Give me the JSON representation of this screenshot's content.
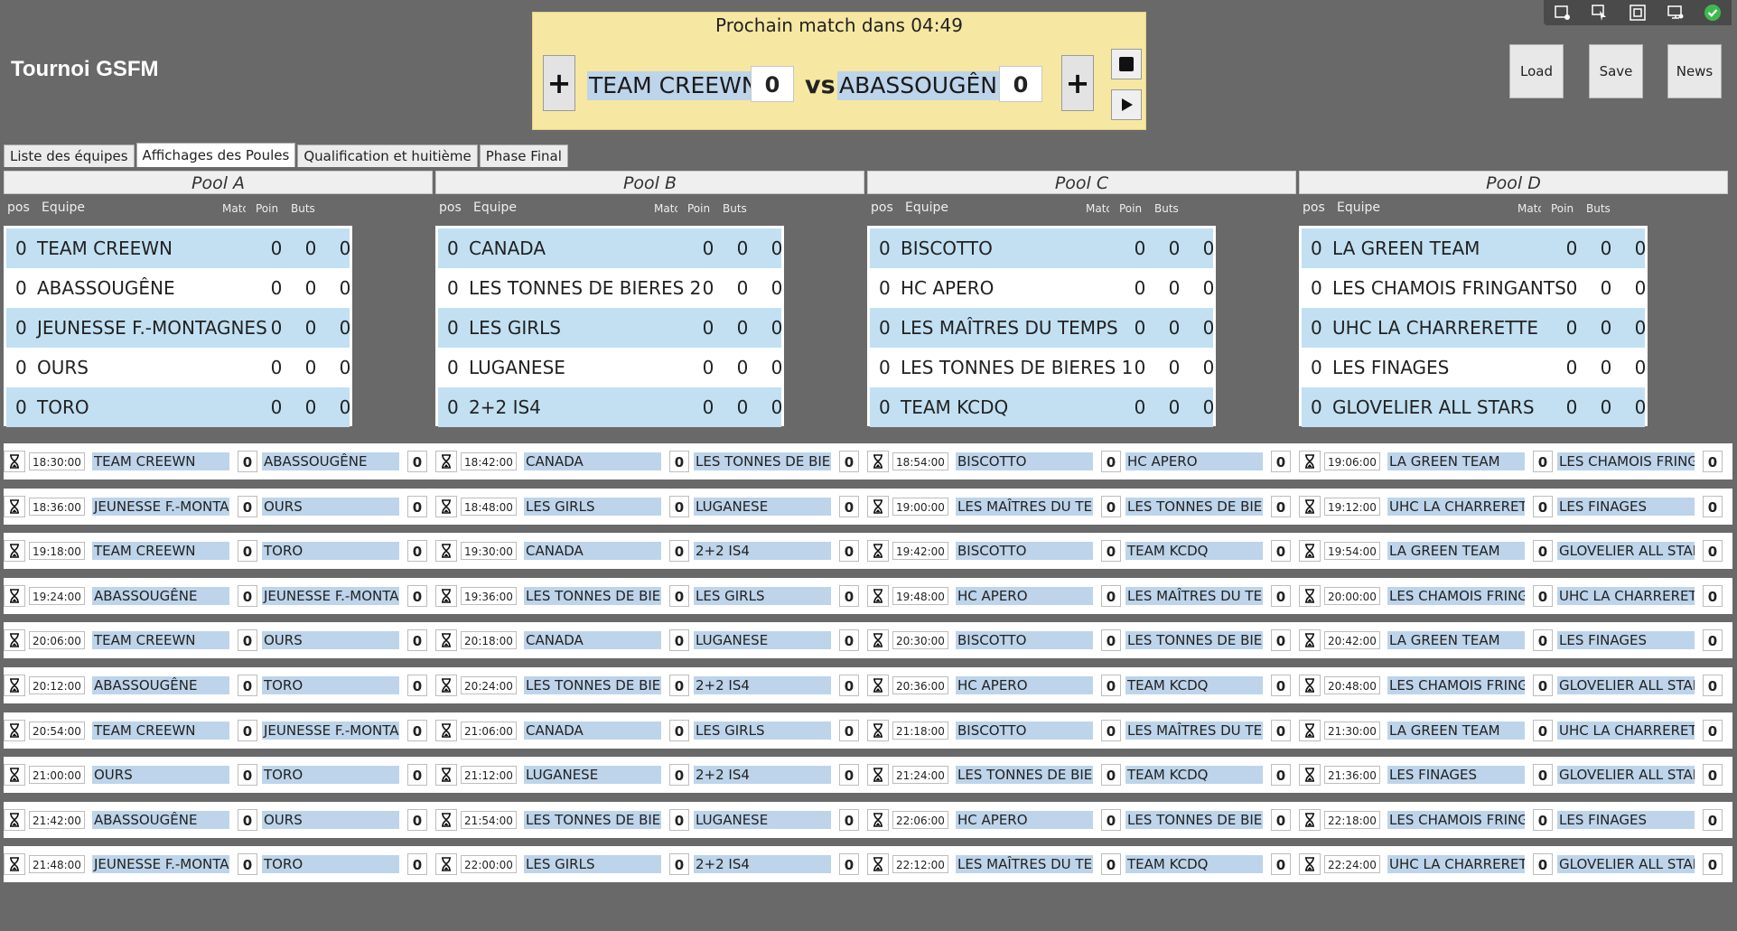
{
  "app": {
    "title": "Tournoi GSFM"
  },
  "tray": {
    "icons": [
      "settings-window-icon",
      "cursor-select-icon",
      "frame-icon",
      "display-settings-icon",
      "check-circle-icon"
    ]
  },
  "next_match": {
    "header": "Prochain match dans 04:49",
    "team_a": "TEAM CREEWN",
    "score_a": "0",
    "vs": "vs",
    "team_b": "ABASSOUGÊNE",
    "score_b": "0",
    "plus_label": "+"
  },
  "buttons": {
    "load": "Load",
    "save": "Save",
    "news": "News"
  },
  "tabs": [
    {
      "label": "Liste des équipes"
    },
    {
      "label": "Affichages des Poules",
      "active": true
    },
    {
      "label": "Qualification  et huitième"
    },
    {
      "label": "Phase Final"
    }
  ],
  "column_headers": {
    "pos": "pos",
    "team": "Equipe",
    "matches": "Matc",
    "points": "Poin",
    "goals": "Buts"
  },
  "pools": [
    {
      "name": "Pool A",
      "teams": [
        {
          "pos": "0",
          "team": "TEAM CREEWN",
          "m": "0",
          "p": "0",
          "b": "0"
        },
        {
          "pos": "0",
          "team": "ABASSOUGÊNE",
          "m": "0",
          "p": "0",
          "b": "0"
        },
        {
          "pos": "0",
          "team": "JEUNESSE F.-MONTAGNES",
          "m": "0",
          "p": "0",
          "b": "0"
        },
        {
          "pos": "0",
          "team": "OURS",
          "m": "0",
          "p": "0",
          "b": "0"
        },
        {
          "pos": "0",
          "team": "TORO",
          "m": "0",
          "p": "0",
          "b": "0"
        }
      ]
    },
    {
      "name": "Pool B",
      "teams": [
        {
          "pos": "0",
          "team": "CANADA",
          "m": "0",
          "p": "0",
          "b": "0"
        },
        {
          "pos": "0",
          "team": "LES TONNES DE BIERES 2",
          "m": "0",
          "p": "0",
          "b": "0"
        },
        {
          "pos": "0",
          "team": "LES GIRLS",
          "m": "0",
          "p": "0",
          "b": "0"
        },
        {
          "pos": "0",
          "team": "LUGANESE",
          "m": "0",
          "p": "0",
          "b": "0"
        },
        {
          "pos": "0",
          "team": "2+2 IS4",
          "m": "0",
          "p": "0",
          "b": "0"
        }
      ]
    },
    {
      "name": "Pool C",
      "teams": [
        {
          "pos": "0",
          "team": "BISCOTTO",
          "m": "0",
          "p": "0",
          "b": "0"
        },
        {
          "pos": "0",
          "team": "HC APERO",
          "m": "0",
          "p": "0",
          "b": "0"
        },
        {
          "pos": "0",
          "team": "LES MAÎTRES DU TEMPS",
          "m": "0",
          "p": "0",
          "b": "0"
        },
        {
          "pos": "0",
          "team": "LES TONNES DE BIERES 1",
          "m": "0",
          "p": "0",
          "b": "0"
        },
        {
          "pos": "0",
          "team": "TEAM KCDQ",
          "m": "0",
          "p": "0",
          "b": "0"
        }
      ]
    },
    {
      "name": "Pool D",
      "teams": [
        {
          "pos": "0",
          "team": "LA GREEN TEAM",
          "m": "0",
          "p": "0",
          "b": "0"
        },
        {
          "pos": "0",
          "team": "LES CHAMOIS FRINGANTS",
          "m": "0",
          "p": "0",
          "b": "0"
        },
        {
          "pos": "0",
          "team": "UHC LA CHARRERETTE",
          "m": "0",
          "p": "0",
          "b": "0"
        },
        {
          "pos": "0",
          "team": "LES FINAGES",
          "m": "0",
          "p": "0",
          "b": "0"
        },
        {
          "pos": "0",
          "team": "GLOVELIER ALL STARS",
          "m": "0",
          "p": "0",
          "b": "0"
        }
      ]
    }
  ],
  "schedule": [
    [
      {
        "time": "18:30:00",
        "a": "TEAM CREEWN",
        "sa": "0",
        "b": "ABASSOUGÊNE",
        "sb": "0"
      },
      {
        "time": "18:42:00",
        "a": "CANADA",
        "sa": "0",
        "b": "LES TONNES DE BIERES",
        "sb": "0"
      },
      {
        "time": "18:54:00",
        "a": "BISCOTTO",
        "sa": "0",
        "b": "HC APERO",
        "sb": "0"
      },
      {
        "time": "19:06:00",
        "a": "LA GREEN TEAM",
        "sa": "0",
        "b": "LES CHAMOIS FRINGAI",
        "sb": "0"
      }
    ],
    [
      {
        "time": "18:36:00",
        "a": "JEUNESSE F.-MONTAGI",
        "sa": "0",
        "b": "OURS",
        "sb": "0"
      },
      {
        "time": "18:48:00",
        "a": "LES GIRLS",
        "sa": "0",
        "b": "LUGANESE",
        "sb": "0"
      },
      {
        "time": "19:00:00",
        "a": "LES MAÎTRES DU TEMP",
        "sa": "0",
        "b": "LES TONNES DE BIERES",
        "sb": "0"
      },
      {
        "time": "19:12:00",
        "a": "UHC LA CHARRERETTE",
        "sa": "0",
        "b": "LES FINAGES",
        "sb": "0"
      }
    ],
    [
      {
        "time": "19:18:00",
        "a": "TEAM CREEWN",
        "sa": "0",
        "b": "TORO",
        "sb": "0"
      },
      {
        "time": "19:30:00",
        "a": "CANADA",
        "sa": "0",
        "b": "2+2 IS4",
        "sb": "0"
      },
      {
        "time": "19:42:00",
        "a": "BISCOTTO",
        "sa": "0",
        "b": "TEAM KCDQ",
        "sb": "0"
      },
      {
        "time": "19:54:00",
        "a": "LA GREEN TEAM",
        "sa": "0",
        "b": "GLOVELIER ALL STARS",
        "sb": "0"
      }
    ],
    [
      {
        "time": "19:24:00",
        "a": "ABASSOUGÊNE",
        "sa": "0",
        "b": "JEUNESSE F.-MONTAGI",
        "sb": "0"
      },
      {
        "time": "19:36:00",
        "a": "LES TONNES DE BIERES",
        "sa": "0",
        "b": "LES GIRLS",
        "sb": "0"
      },
      {
        "time": "19:48:00",
        "a": "HC APERO",
        "sa": "0",
        "b": "LES MAÎTRES DU TEMP",
        "sb": "0"
      },
      {
        "time": "20:00:00",
        "a": "LES CHAMOIS FRINGAI",
        "sa": "0",
        "b": "UHC LA CHARRERETTE",
        "sb": "0"
      }
    ],
    [
      {
        "time": "20:06:00",
        "a": "TEAM CREEWN",
        "sa": "0",
        "b": "OURS",
        "sb": "0"
      },
      {
        "time": "20:18:00",
        "a": "CANADA",
        "sa": "0",
        "b": "LUGANESE",
        "sb": "0"
      },
      {
        "time": "20:30:00",
        "a": "BISCOTTO",
        "sa": "0",
        "b": "LES TONNES DE BIERES",
        "sb": "0"
      },
      {
        "time": "20:42:00",
        "a": "LA GREEN TEAM",
        "sa": "0",
        "b": "LES FINAGES",
        "sb": "0"
      }
    ],
    [
      {
        "time": "20:12:00",
        "a": "ABASSOUGÊNE",
        "sa": "0",
        "b": "TORO",
        "sb": "0"
      },
      {
        "time": "20:24:00",
        "a": "LES TONNES DE BIERES",
        "sa": "0",
        "b": "2+2 IS4",
        "sb": "0"
      },
      {
        "time": "20:36:00",
        "a": "HC APERO",
        "sa": "0",
        "b": "TEAM KCDQ",
        "sb": "0"
      },
      {
        "time": "20:48:00",
        "a": "LES CHAMOIS FRINGAI",
        "sa": "0",
        "b": "GLOVELIER ALL STARS",
        "sb": "0"
      }
    ],
    [
      {
        "time": "20:54:00",
        "a": "TEAM CREEWN",
        "sa": "0",
        "b": "JEUNESSE F.-MONTAGI",
        "sb": "0"
      },
      {
        "time": "21:06:00",
        "a": "CANADA",
        "sa": "0",
        "b": "LES GIRLS",
        "sb": "0"
      },
      {
        "time": "21:18:00",
        "a": "BISCOTTO",
        "sa": "0",
        "b": "LES MAÎTRES DU TEMP",
        "sb": "0"
      },
      {
        "time": "21:30:00",
        "a": "LA GREEN TEAM",
        "sa": "0",
        "b": "UHC LA CHARRERETTE",
        "sb": "0"
      }
    ],
    [
      {
        "time": "21:00:00",
        "a": "OURS",
        "sa": "0",
        "b": "TORO",
        "sb": "0"
      },
      {
        "time": "21:12:00",
        "a": "LUGANESE",
        "sa": "0",
        "b": "2+2 IS4",
        "sb": "0"
      },
      {
        "time": "21:24:00",
        "a": "LES TONNES DE BIERES",
        "sa": "0",
        "b": "TEAM KCDQ",
        "sb": "0"
      },
      {
        "time": "21:36:00",
        "a": "LES FINAGES",
        "sa": "0",
        "b": "GLOVELIER ALL STARS",
        "sb": "0"
      }
    ],
    [
      {
        "time": "21:42:00",
        "a": "ABASSOUGÊNE",
        "sa": "0",
        "b": "OURS",
        "sb": "0"
      },
      {
        "time": "21:54:00",
        "a": "LES TONNES DE BIERES",
        "sa": "0",
        "b": "LUGANESE",
        "sb": "0"
      },
      {
        "time": "22:06:00",
        "a": "HC APERO",
        "sa": "0",
        "b": "LES TONNES DE BIERES",
        "sb": "0"
      },
      {
        "time": "22:18:00",
        "a": "LES CHAMOIS FRINGAI",
        "sa": "0",
        "b": "LES FINAGES",
        "sb": "0"
      }
    ],
    [
      {
        "time": "21:48:00",
        "a": "JEUNESSE F.-MONTAGI",
        "sa": "0",
        "b": "TORO",
        "sb": "0"
      },
      {
        "time": "22:00:00",
        "a": "LES GIRLS",
        "sa": "0",
        "b": "2+2 IS4",
        "sb": "0"
      },
      {
        "time": "22:12:00",
        "a": "LES MAÎTRES DU TEMP",
        "sa": "0",
        "b": "TEAM KCDQ",
        "sb": "0"
      },
      {
        "time": "22:24:00",
        "a": "UHC LA CHARRERETTE",
        "sa": "0",
        "b": "GLOVELIER ALL STARS",
        "sb": "0"
      }
    ]
  ]
}
